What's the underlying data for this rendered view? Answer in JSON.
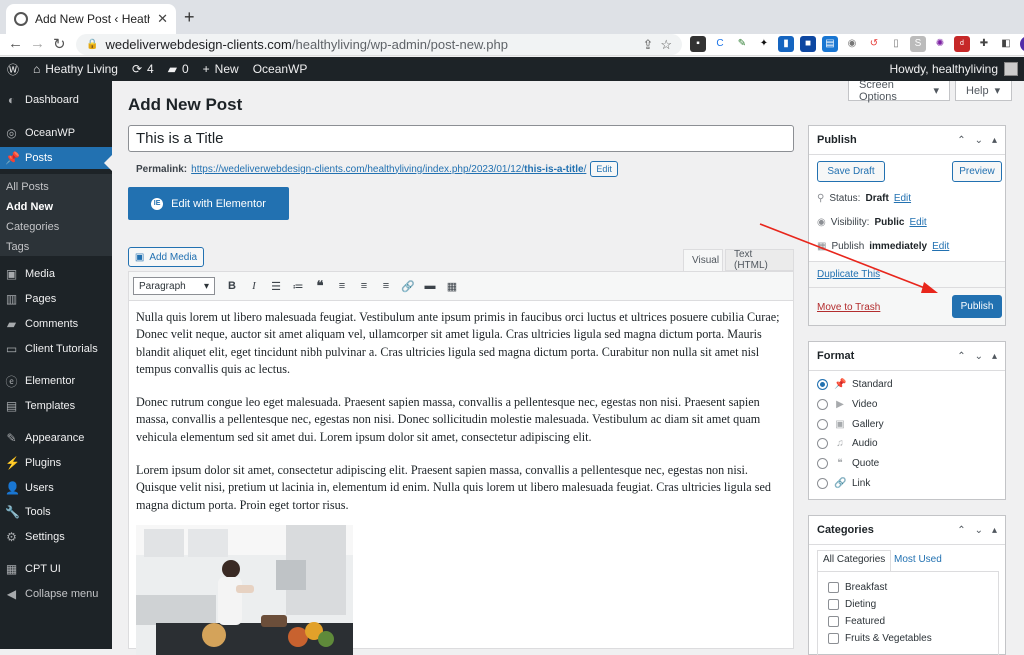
{
  "browser": {
    "tab_title": "Add New Post ‹ Heathy Living",
    "url_host": "wedeliverwebdesign-clients.com",
    "url_path": "/healthyliving/wp-admin/post-new.php"
  },
  "adminbar": {
    "site_name": "Heathy Living",
    "updates": "4",
    "comments": "0",
    "new_label": "New",
    "theme_label": "OceanWP",
    "howdy": "Howdy, healthyliving"
  },
  "sidebar": {
    "items": [
      {
        "label": "Dashboard",
        "icon": "dashboard-icon"
      },
      {
        "label": "OceanWP",
        "icon": "oceanwp-icon"
      },
      {
        "label": "Posts",
        "icon": "pin-icon"
      },
      {
        "label": "Media",
        "icon": "media-icon"
      },
      {
        "label": "Pages",
        "icon": "pages-icon"
      },
      {
        "label": "Comments",
        "icon": "comments-icon"
      },
      {
        "label": "Client Tutorials",
        "icon": "tutorials-icon"
      },
      {
        "label": "Elementor",
        "icon": "elementor-icon"
      },
      {
        "label": "Templates",
        "icon": "folder-icon"
      },
      {
        "label": "Appearance",
        "icon": "appearance-icon"
      },
      {
        "label": "Plugins",
        "icon": "plugins-icon"
      },
      {
        "label": "Users",
        "icon": "users-icon"
      },
      {
        "label": "Tools",
        "icon": "tools-icon"
      },
      {
        "label": "Settings",
        "icon": "settings-icon"
      },
      {
        "label": "CPT UI",
        "icon": "cptui-icon"
      },
      {
        "label": "Collapse menu",
        "icon": "collapse-icon"
      }
    ],
    "submenu": [
      "All Posts",
      "Add New",
      "Categories",
      "Tags"
    ]
  },
  "header": {
    "page_title": "Add New Post",
    "screen_options": "Screen Options",
    "help": "Help"
  },
  "post": {
    "title": "This is a Title",
    "permalink_label": "Permalink:",
    "permalink_base": "https://wedeliverwebdesign-clients.com/healthyliving/index.php/2023/01/12/",
    "permalink_slug": "this-is-a-title",
    "permalink_end": "/",
    "permalink_edit": "Edit",
    "elementor_button": "Edit with Elementor",
    "add_media": "Add Media",
    "tab_visual": "Visual",
    "tab_text": "Text (HTML)",
    "format_select": "Paragraph",
    "paragraphs": [
      "Nulla quis lorem ut libero malesuada feugiat. Vestibulum ante ipsum primis in faucibus orci luctus et ultrices posuere cubilia Curae; Donec velit neque, auctor sit amet aliquam vel, ullamcorper sit amet ligula. Cras ultricies ligula sed magna dictum porta. Mauris blandit aliquet elit, eget tincidunt nibh pulvinar a. Cras ultricies ligula sed magna dictum porta. Curabitur non nulla sit amet nisl tempus convallis quis ac lectus.",
      "Donec rutrum congue leo eget malesuada. Praesent sapien massa, convallis a pellentesque nec, egestas non nisi. Praesent sapien massa, convallis a pellentesque nec, egestas non nisi. Donec sollicitudin molestie malesuada. Vestibulum ac diam sit amet quam vehicula elementum sed sit amet dui. Lorem ipsum dolor sit amet, consectetur adipiscing elit.",
      "Lorem ipsum dolor sit amet, consectetur adipiscing elit. Praesent sapien massa, convallis a pellentesque nec, egestas non nisi. Quisque velit nisi, pretium ut lacinia in, elementum id enim. Nulla quis lorem ut libero malesuada feugiat. Cras ultricies ligula sed magna dictum porta. Proin eget tortor risus."
    ]
  },
  "publish_box": {
    "title": "Publish",
    "save_draft": "Save Draft",
    "preview": "Preview",
    "status_label": "Status:",
    "status_value": "Draft",
    "visibility_label": "Visibility:",
    "visibility_value": "Public",
    "publish_label": "Publish",
    "publish_value": "immediately",
    "edit": "Edit",
    "duplicate": "Duplicate This",
    "trash": "Move to Trash",
    "publish_button": "Publish"
  },
  "format_box": {
    "title": "Format",
    "options": [
      {
        "label": "Standard",
        "icon": "pin-icon",
        "selected": true
      },
      {
        "label": "Video",
        "icon": "video-icon",
        "selected": false
      },
      {
        "label": "Gallery",
        "icon": "gallery-icon",
        "selected": false
      },
      {
        "label": "Audio",
        "icon": "audio-icon",
        "selected": false
      },
      {
        "label": "Quote",
        "icon": "quote-icon",
        "selected": false
      },
      {
        "label": "Link",
        "icon": "link-icon",
        "selected": false
      }
    ]
  },
  "categories_box": {
    "title": "Categories",
    "tab_all": "All Categories",
    "tab_used": "Most Used",
    "items": [
      "Breakfast",
      "Dieting",
      "Featured",
      "Fruits & Vegetables"
    ]
  },
  "colors": {
    "admin_dark": "#1d2327",
    "primary_blue": "#2271b1",
    "trash_red": "#b32d2e",
    "annotation_red": "#e8261c"
  }
}
